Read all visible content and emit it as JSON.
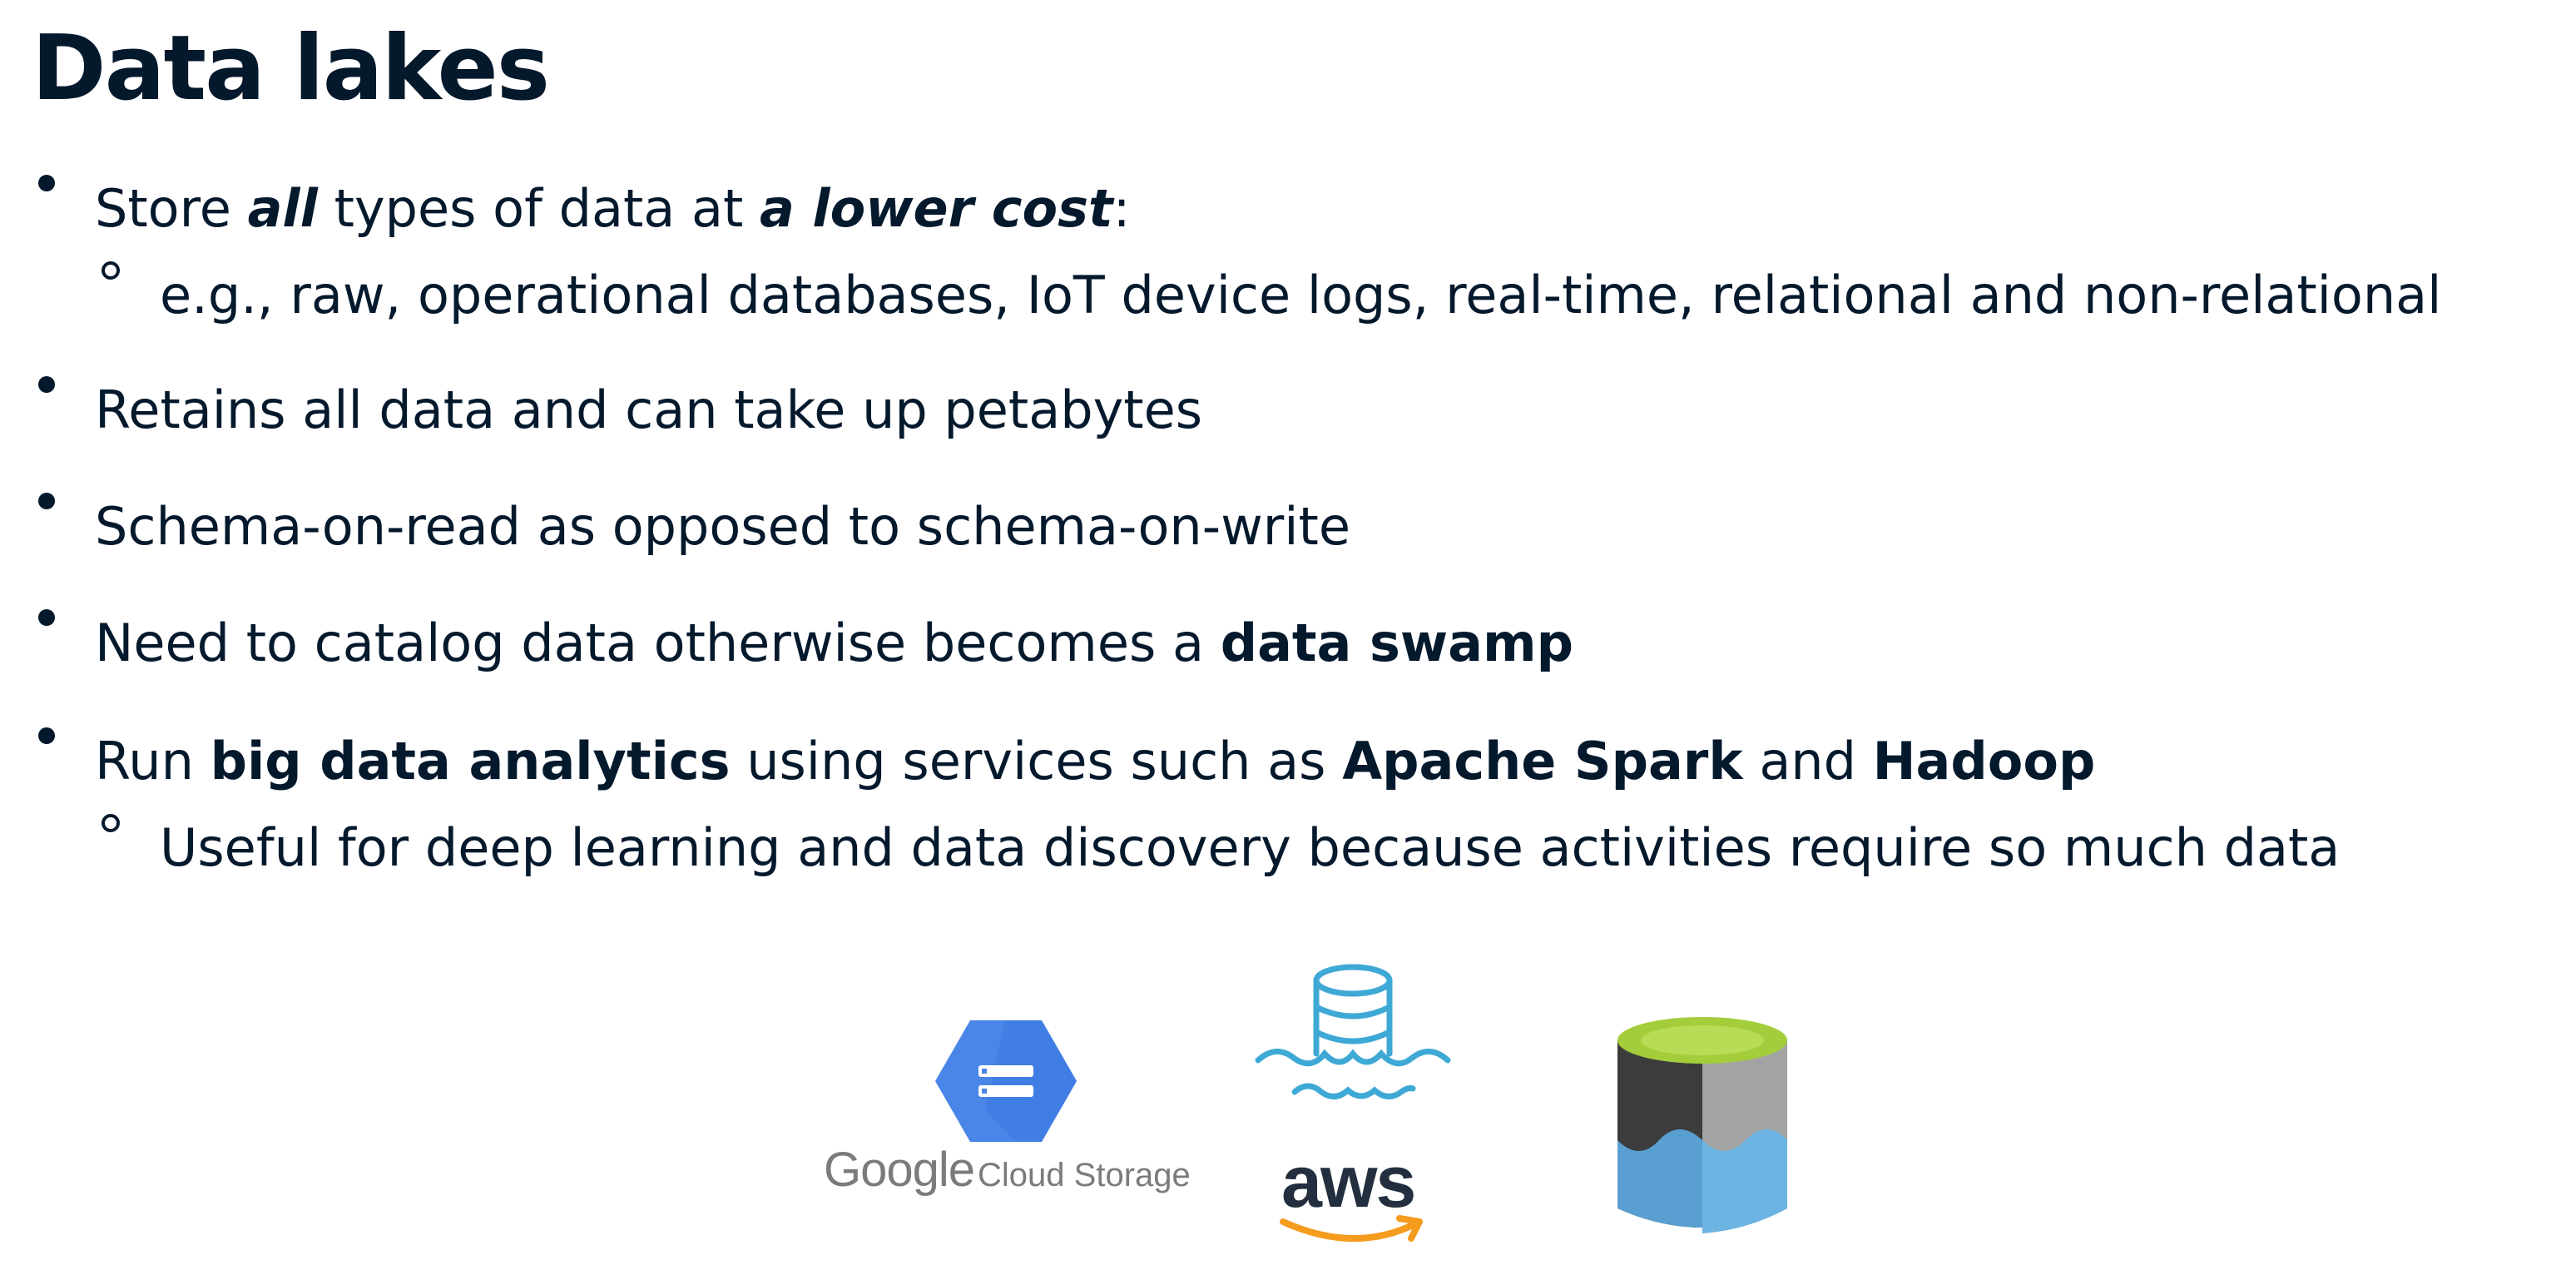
{
  "slide": {
    "title": "Data lakes",
    "bullets": {
      "b1": {
        "p1": "Store ",
        "em1": "all",
        "p2": " types of data at ",
        "em2": "a lower cost",
        "p3": ":",
        "sub": "e.g., raw, operational databases, IoT device logs, real-time, relational and non-relational"
      },
      "b2": "Retains all data and can take up petabytes",
      "b3": "Schema-on-read as opposed to schema-on-write",
      "b4": {
        "p1": "Need to catalog data otherwise becomes a ",
        "strong": "data swamp"
      },
      "b5": {
        "p1": "Run ",
        "s1": "big data analytics",
        "p2": " using services such as ",
        "s2": "Apache Spark",
        "p3": " and ",
        "s3": "Hadoop",
        "sub": "Useful for deep learning and data discovery because activities require so much data"
      }
    }
  },
  "logos": {
    "google": {
      "word1": "Google",
      "word2": "Cloud Storage",
      "icon": "google-cloud-storage-icon"
    },
    "aws": {
      "word": "aws",
      "icon": "aws-data-lake-icon"
    },
    "azure": {
      "icon": "azure-data-lake-icon"
    }
  },
  "colors": {
    "text": "#05192d",
    "gcs_blue": "#4a86e8",
    "aws_teal": "#3fa9d6",
    "aws_orange": "#f59b1e",
    "azure_green": "#a3cd3a"
  }
}
